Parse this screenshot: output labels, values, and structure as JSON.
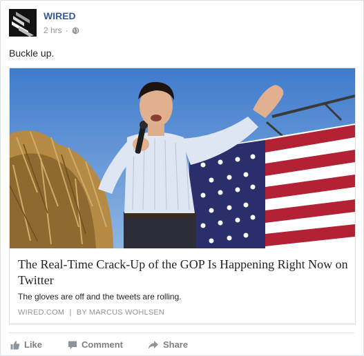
{
  "post": {
    "page_name": "WIRED",
    "timestamp": "2 hrs",
    "separator": "·",
    "privacy_icon": "globe-icon",
    "text": "Buckle up."
  },
  "link_card": {
    "title": "The Real-Time Crack-Up of the GOP Is Happening Right Now on Twitter",
    "description": "The gloves are off and the tweets are rolling.",
    "source": "WIRED.COM",
    "source_separator": "|",
    "byline": "BY MARCUS WOHLSEN"
  },
  "actions": {
    "like": "Like",
    "comment": "Comment",
    "share": "Share"
  },
  "colors": {
    "link_blue": "#365899",
    "meta_gray": "#90949c",
    "action_gray": "#7f7f7f",
    "sky": "#5b8ccd"
  }
}
